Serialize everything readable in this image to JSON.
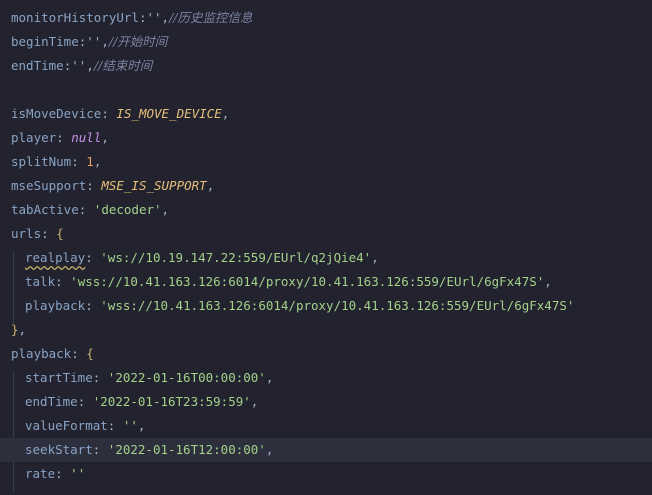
{
  "editor": {
    "lines": [
      {
        "type": "comment_prop",
        "key": "monitorHistoryUrl",
        "value": "''",
        "comment": "//历史监控信息"
      },
      {
        "type": "comment_prop",
        "key": "beginTime",
        "value": "''",
        "comment": "//开始时间"
      },
      {
        "type": "comment_prop",
        "key": "endTime",
        "value": "''",
        "comment": "//结束时间"
      },
      {
        "type": "blank"
      },
      {
        "type": "prop",
        "key": "isMoveDevice",
        "value": "IS_MOVE_DEVICE",
        "valueKind": "const"
      },
      {
        "type": "prop",
        "key": "player",
        "value": "null",
        "valueKind": "kw"
      },
      {
        "type": "prop",
        "key": "splitNum",
        "value": "1",
        "valueKind": "num"
      },
      {
        "type": "prop",
        "key": "mseSupport",
        "value": "MSE_IS_SUPPORT",
        "valueKind": "const"
      },
      {
        "type": "prop",
        "key": "tabActive",
        "value": "'decoder'",
        "valueKind": "str"
      },
      {
        "type": "open",
        "key": "urls",
        "brace": "{"
      },
      {
        "type": "prop",
        "indent": true,
        "key": "realplay",
        "squiggly": true,
        "value": "'ws://10.19.147.22:559/EUrl/q2jQie4'",
        "valueKind": "str"
      },
      {
        "type": "prop",
        "indent": true,
        "key": "talk",
        "value": "'wss://10.41.163.126:6014/proxy/10.41.163.126:559/EUrl/6gFx47S'",
        "valueKind": "str"
      },
      {
        "type": "prop",
        "indent": true,
        "key": "playback",
        "value": "'wss://10.41.163.126:6014/proxy/10.41.163.126:559/EUrl/6gFx47S'",
        "valueKind": "str",
        "last": true
      },
      {
        "type": "close",
        "brace": "}"
      },
      {
        "type": "open",
        "key": "playback",
        "brace": "{"
      },
      {
        "type": "prop",
        "indent": true,
        "key": "startTime",
        "value": "'2022-01-16T00:00:00'",
        "valueKind": "str"
      },
      {
        "type": "prop",
        "indent": true,
        "key": "endTime",
        "value": "'2022-01-16T23:59:59'",
        "valueKind": "str"
      },
      {
        "type": "prop",
        "indent": true,
        "key": "valueFormat",
        "value": "''",
        "valueKind": "str"
      },
      {
        "type": "prop",
        "indent": true,
        "key": "seekStart",
        "value": "'2022-01-16T12:00:00'",
        "valueKind": "str",
        "highlight": true
      },
      {
        "type": "prop",
        "indent": true,
        "key": "rate",
        "value": "''",
        "valueKind": "str",
        "last": true
      }
    ]
  }
}
